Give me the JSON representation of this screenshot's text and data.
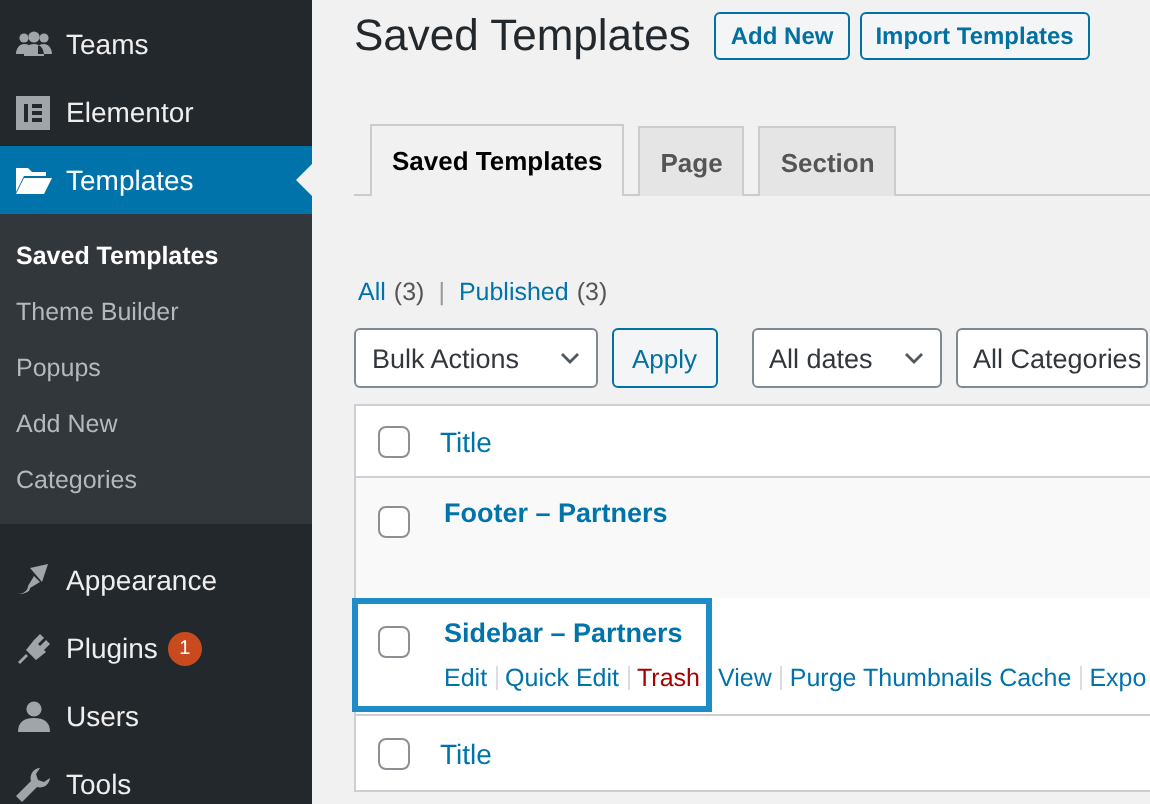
{
  "sidebar": {
    "items": [
      {
        "label": "Teams",
        "selected": false
      },
      {
        "label": "Elementor",
        "selected": false
      },
      {
        "label": "Templates",
        "selected": true,
        "submenu": [
          {
            "label": "Saved Templates",
            "selected": true
          },
          {
            "label": "Theme Builder",
            "selected": false
          },
          {
            "label": "Popups",
            "selected": false
          },
          {
            "label": "Add New",
            "selected": false
          },
          {
            "label": "Categories",
            "selected": false
          }
        ]
      },
      {
        "label": "Appearance",
        "selected": false
      },
      {
        "label": "Plugins",
        "selected": false,
        "badge": "1"
      },
      {
        "label": "Users",
        "selected": false
      },
      {
        "label": "Tools",
        "selected": false
      }
    ]
  },
  "page_title": "Saved Templates",
  "header_buttons": [
    "Add New",
    "Import Templates"
  ],
  "tabs": [
    {
      "label": "Saved Templates",
      "selected": true
    },
    {
      "label": "Page",
      "selected": false
    },
    {
      "label": "Section",
      "selected": false
    }
  ],
  "filters": [
    {
      "label": "All",
      "count": "(3)"
    },
    {
      "label": "Published",
      "count": "(3)"
    }
  ],
  "filter_separator": "|",
  "bulk_actions": {
    "select": "Bulk Actions",
    "button": "Apply"
  },
  "dropdowns": [
    "All dates",
    "All Categories"
  ],
  "table": {
    "header": "Title",
    "footer": "Title",
    "header_checked": false,
    "footer_checked": false,
    "rows": [
      {
        "title": "Footer – Partners",
        "checked": false,
        "highlighted": false,
        "actions": []
      },
      {
        "title": "Sidebar – Partners",
        "checked": false,
        "highlighted": true,
        "actions": [
          {
            "label": "Edit",
            "kind": "link"
          },
          {
            "label": "Quick Edit",
            "kind": "link"
          },
          {
            "label": "Trash",
            "kind": "delete"
          },
          {
            "label": "View",
            "kind": "link"
          },
          {
            "label": "Purge Thumbnails Cache",
            "kind": "link"
          },
          {
            "label": "Expo",
            "kind": "link"
          }
        ]
      }
    ]
  }
}
